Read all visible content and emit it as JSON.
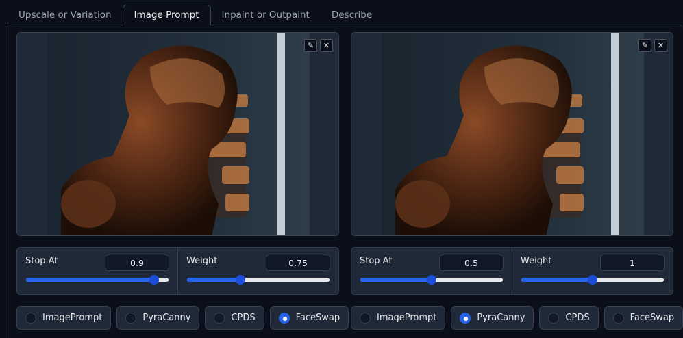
{
  "tabs": [
    {
      "label": "Upscale or Variation",
      "active": false
    },
    {
      "label": "Image Prompt",
      "active": true
    },
    {
      "label": "Inpaint or Outpaint",
      "active": false
    },
    {
      "label": "Describe",
      "active": false
    }
  ],
  "panels": [
    {
      "stop_at": {
        "label": "Stop At",
        "value": "0.9",
        "fraction": 0.9
      },
      "weight": {
        "label": "Weight",
        "value": "0.75",
        "fraction": 0.375
      },
      "options": [
        {
          "label": "ImagePrompt",
          "checked": false
        },
        {
          "label": "PyraCanny",
          "checked": false
        },
        {
          "label": "CPDS",
          "checked": false
        },
        {
          "label": "FaceSwap",
          "checked": true
        }
      ]
    },
    {
      "stop_at": {
        "label": "Stop At",
        "value": "0.5",
        "fraction": 0.5
      },
      "weight": {
        "label": "Weight",
        "value": "1",
        "fraction": 0.5
      },
      "options": [
        {
          "label": "ImagePrompt",
          "checked": false
        },
        {
          "label": "PyraCanny",
          "checked": true
        },
        {
          "label": "CPDS",
          "checked": false
        },
        {
          "label": "FaceSwap",
          "checked": false
        }
      ]
    }
  ],
  "icons": {
    "edit": "pencil-icon",
    "close": "close-icon"
  },
  "colors": {
    "accent": "#2563eb",
    "background": "#0b0f19",
    "panel": "#1f2937"
  }
}
